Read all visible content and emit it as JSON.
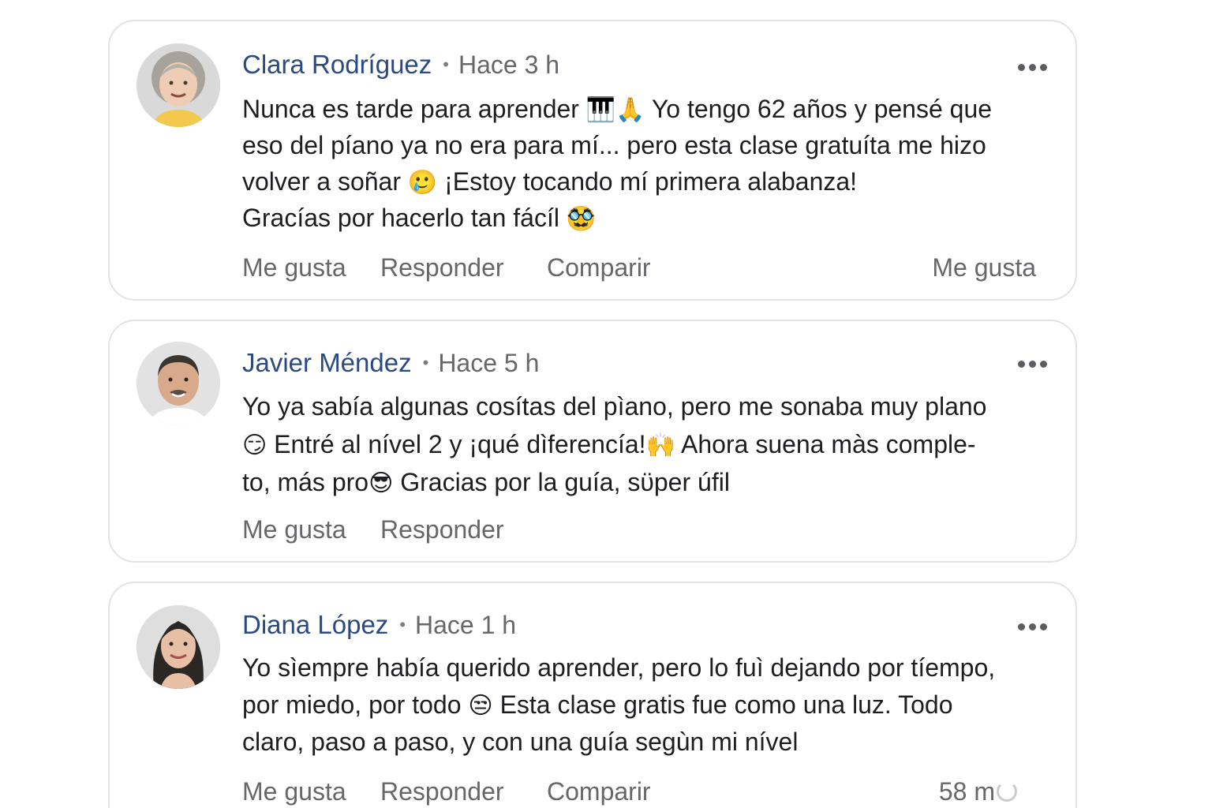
{
  "comments": [
    {
      "author": "Clara Rodríguez",
      "separator": "•",
      "time": "Hace 3 h",
      "more_icon": "more-horizontal-icon",
      "lines": [
        [
          "Nunca es tarde para aprender ",
          "🎹🙏",
          " Yo tengo 62 años y pensé que"
        ],
        [
          "eso del píano ya no era para mí... pero esta clase gratuíta me hizo",
          "",
          ""
        ],
        [
          "volver a soñar ",
          "🥲",
          " ¡Estoy tocando mí primera alabanza!"
        ],
        [
          "Gracías por hacerlo tan fácíl ",
          "🥸",
          ""
        ]
      ],
      "actions": {
        "like": "Me gusta",
        "reply": "Responder",
        "share": "Comparir",
        "right": "Me gusta"
      }
    },
    {
      "author": "Javier Méndez",
      "separator": "•",
      "time": "Hace 5 h",
      "more_icon": "more-horizontal-icon",
      "lines": [
        [
          "Yo ya sabía algunas cosítas del pìano, pero me sonaba muy plano",
          "",
          ""
        ],
        [
          "",
          "😏",
          " Entré al nível 2 y ¡qué dìferencía!"
        ],
        [
          "",
          "🙌",
          " Ahora suena màs comple-"
        ],
        [
          "to, más pro",
          "😎",
          " Gracias por la guía, sϋper úfil"
        ]
      ],
      "actions": {
        "like": "Me gusta",
        "reply": "Responder"
      }
    },
    {
      "author": "Diana López",
      "separator": "•",
      "time": "Hace 1 h",
      "more_icon": "more-horizontal-icon",
      "lines": [
        [
          "Yo sìempre había querido aprender, pero lo fuì dejando por tíempo,",
          "",
          ""
        ],
        [
          "por miedo, por todo ",
          "😒",
          " Esta clase gratis fue como una luz. Todo"
        ],
        [
          "claro, paso a paso, y con una guía segùn mi nível",
          "",
          ""
        ]
      ],
      "actions": {
        "like": "Me gusta",
        "reply": "Responder",
        "share": "Comparir",
        "right": "58 m"
      }
    }
  ],
  "colors": {
    "author": "#2c4a82",
    "meta": "#65676b",
    "text": "#1c1e21",
    "border": "#e1e3e6"
  }
}
